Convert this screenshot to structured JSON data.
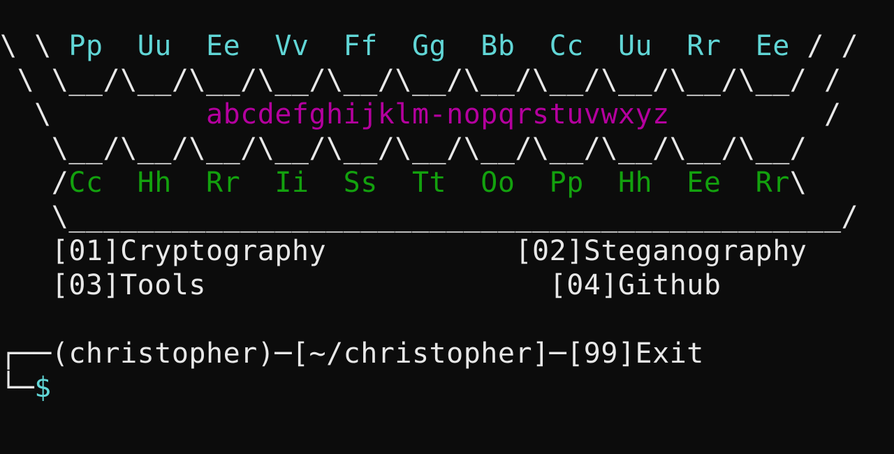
{
  "banner": {
    "row1_left": "\\ \\ ",
    "row1_letters": "Pp  Uu  Ee  Vv  Ff  Gg  Bb  Cc  Uu  Rr  Ee",
    "row1_right": " / /",
    "row2": " \\ \\__/\\__/\\__/\\__/\\__/\\__/\\__/\\__/\\__/\\__/\\__/ /",
    "row3_left": "  \\         ",
    "row3_alphabet": "abcdefghijklm-nopqrstuvwxyz",
    "row3_right": "         /",
    "row4": "   \\__/\\__/\\__/\\__/\\__/\\__/\\__/\\__/\\__/\\__/\\__/",
    "row5_left": "   /",
    "row5_letters": "Cc  Hh  Rr  Ii  Ss  Tt  Oo  Pp  Hh  Ee  Rr",
    "row5_right": "\\",
    "row6": "   \\_____________________________________________/"
  },
  "menu": {
    "item1": "[01]Cryptography",
    "item2": "[02]Steganography",
    "item3": "[03]Tools",
    "item4": "[04]Github"
  },
  "prompt": {
    "line1_prefix": "┌──",
    "line1_text": "(christopher)─[~/christopher]─[99]Exit",
    "line2_prefix": "└─",
    "symbol": "$"
  },
  "colors": {
    "background": "#0c0c0c",
    "cyan": "#61d6d6",
    "magenta": "#b4009e",
    "green": "#13a10e",
    "white": "#e8e8e8"
  }
}
